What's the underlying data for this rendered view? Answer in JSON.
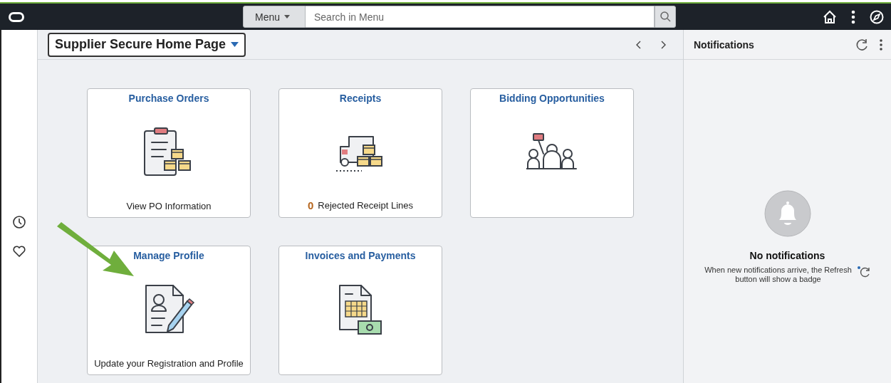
{
  "top_bar": {
    "menu_button": "Menu",
    "search": {
      "placeholder": "Search in Menu"
    }
  },
  "header": {
    "title": "Supplier Secure Home Page"
  },
  "tiles": [
    {
      "title": "Purchase Orders",
      "kind": "clipboard",
      "footer": "View PO Information"
    },
    {
      "title": "Receipts",
      "kind": "truck",
      "count": "0",
      "footer": "Rejected Receipt Lines"
    },
    {
      "title": "Bidding Opportunities",
      "kind": "auction"
    },
    {
      "title": "Manage Profile",
      "kind": "profile",
      "footer": "Update your Registration and Profile"
    },
    {
      "title": "Invoices and Payments",
      "kind": "invoice"
    }
  ],
  "notifications": {
    "title": "Notifications",
    "empty_title": "No notifications",
    "empty_text": "When new notifications arrive, the Refresh button will show a badge"
  }
}
